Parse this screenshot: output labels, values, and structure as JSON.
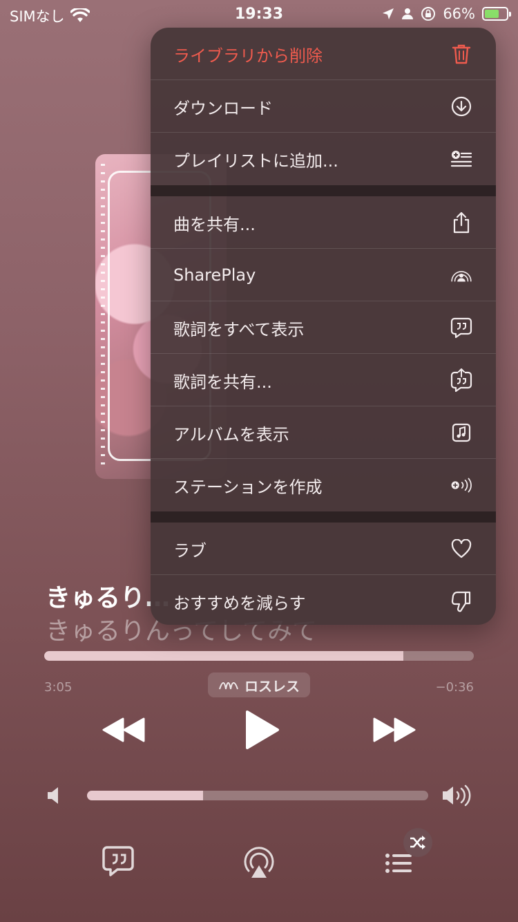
{
  "status_bar": {
    "carrier": "SIMなし",
    "time": "19:33",
    "battery": "66%",
    "battery_level": 0.66
  },
  "track": {
    "title": "きゅるり…",
    "artist": "きゅるりんってしてみて",
    "elapsed": "3:05",
    "remaining": "−0:36",
    "progress": 0.836,
    "quality_badge": "ロスレス"
  },
  "volume": {
    "level": 0.34
  },
  "menu": {
    "items": [
      {
        "label": "ライブラリから削除",
        "icon": "trash-icon",
        "destructive": true
      },
      {
        "label": "ダウンロード",
        "icon": "download-icon"
      },
      {
        "label": "プレイリストに追加...",
        "icon": "add-to-playlist-icon"
      },
      {
        "label": "曲を共有...",
        "icon": "share-icon"
      },
      {
        "label": "SharePlay",
        "icon": "shareplay-icon"
      },
      {
        "label": "歌詞をすべて表示",
        "icon": "lyrics-icon"
      },
      {
        "label": "歌詞を共有...",
        "icon": "share-lyrics-icon"
      },
      {
        "label": "アルバムを表示",
        "icon": "album-icon"
      },
      {
        "label": "ステーションを作成",
        "icon": "station-icon"
      },
      {
        "label": "ラブ",
        "icon": "heart-icon"
      },
      {
        "label": "おすすめを減らす",
        "icon": "thumbs-down-icon"
      }
    ]
  },
  "colors": {
    "destructive": "#ef5b4e",
    "battery_fill": "#8be06a"
  }
}
